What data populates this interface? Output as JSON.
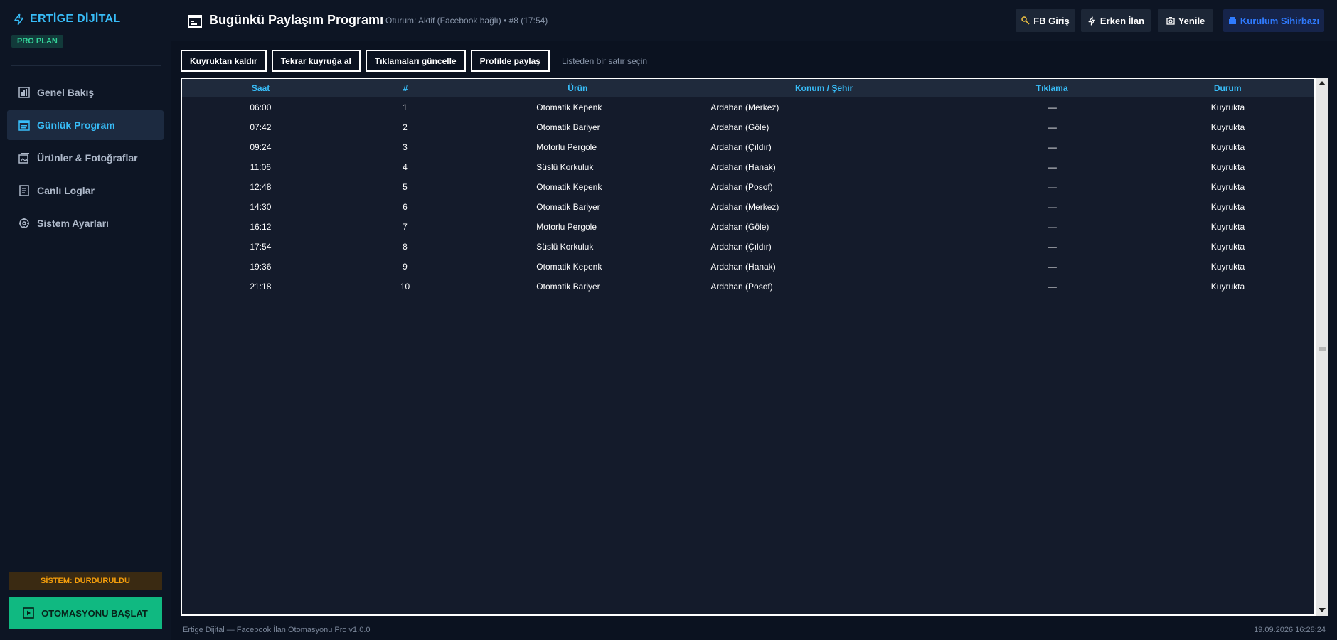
{
  "app": {
    "brand": "ERTİGE DİJİTAL",
    "plan": "PRO PLAN",
    "brand_color": "#38bdf8"
  },
  "sidebar": {
    "items": [
      {
        "label": "Genel Bakış",
        "icon": "chart-icon"
      },
      {
        "label": "Günlük Program",
        "icon": "calendar-icon",
        "active": true
      },
      {
        "label": "Ürünler & Fotoğraflar",
        "icon": "image-icon"
      },
      {
        "label": "Canlı Loglar",
        "icon": "log-icon"
      },
      {
        "label": "Sistem Ayarları",
        "icon": "settings-icon"
      }
    ],
    "system_status": "SİSTEM: DURDURULDU",
    "start_label": "OTOMASYONU BAŞLAT"
  },
  "header": {
    "title": "Bugünkü Paylaşım Programı",
    "session": "Oturum: Aktif (Facebook bağlı)  •  #8 (17:54)",
    "buttons": {
      "fb_login": "FB Giriş",
      "early_post": "Erken İlan",
      "refresh": "Yenile",
      "wizard": "Kurulum Sihirbazı"
    }
  },
  "toolbar": {
    "remove": "Kuyruktan kaldır",
    "requeue": "Tekrar kuyruğa al",
    "update_clicks": "Tıklamaları güncelle",
    "share_profile": "Profilde paylaş",
    "hint": "Listeden bir satır seçin"
  },
  "table": {
    "columns": [
      "Saat",
      "#",
      "Ürün",
      "Konum / Şehir",
      "Tıklama",
      "Durum"
    ],
    "rows": [
      [
        "06:00",
        "1",
        "Otomatik Kepenk",
        "Ardahan (Merkez)",
        "—",
        "Kuyrukta"
      ],
      [
        "07:42",
        "2",
        "Otomatik Bariyer",
        "Ardahan (Göle)",
        "—",
        "Kuyrukta"
      ],
      [
        "09:24",
        "3",
        "Motorlu Pergole",
        "Ardahan (Çıldır)",
        "—",
        "Kuyrukta"
      ],
      [
        "11:06",
        "4",
        "Süslü Korkuluk",
        "Ardahan (Hanak)",
        "—",
        "Kuyrukta"
      ],
      [
        "12:48",
        "5",
        "Otomatik Kepenk",
        "Ardahan (Posof)",
        "—",
        "Kuyrukta"
      ],
      [
        "14:30",
        "6",
        "Otomatik Bariyer",
        "Ardahan (Merkez)",
        "—",
        "Kuyrukta"
      ],
      [
        "16:12",
        "7",
        "Motorlu Pergole",
        "Ardahan (Göle)",
        "—",
        "Kuyrukta"
      ],
      [
        "17:54",
        "8",
        "Süslü Korkuluk",
        "Ardahan (Çıldır)",
        "—",
        "Kuyrukta"
      ],
      [
        "19:36",
        "9",
        "Otomatik Kepenk",
        "Ardahan (Hanak)",
        "—",
        "Kuyrukta"
      ],
      [
        "21:18",
        "10",
        "Otomatik Bariyer",
        "Ardahan (Posof)",
        "—",
        "Kuyrukta"
      ]
    ]
  },
  "footer": {
    "left": "Ertige Dijital — Facebook İlan Otomasyonu Pro v1.0.0",
    "right": "19.09.2026 16:28:24"
  }
}
